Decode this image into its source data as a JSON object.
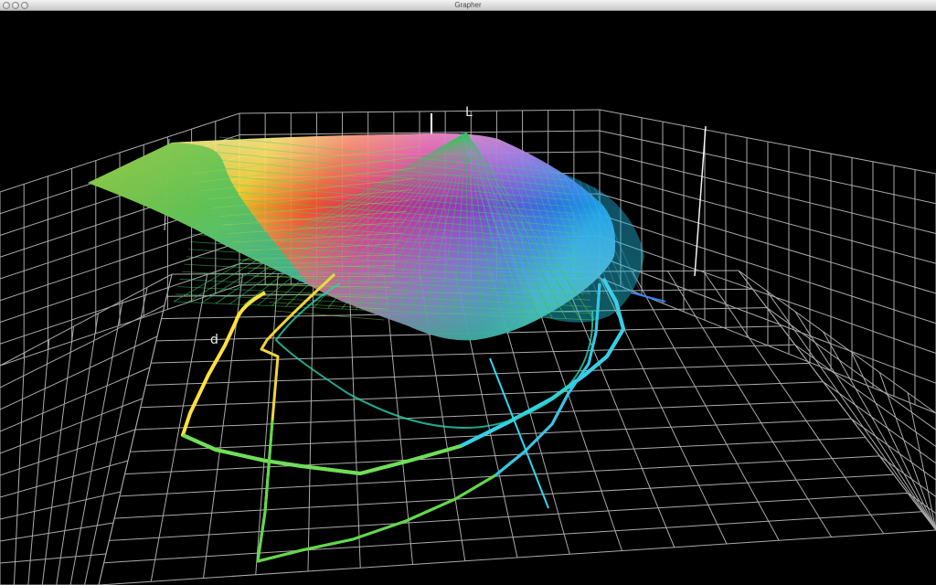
{
  "window": {
    "title": "Grapher",
    "buttons": [
      "close",
      "minimize",
      "zoom"
    ]
  },
  "plot": {
    "axis_labels": {
      "vertical": "L",
      "horizontal": "d"
    },
    "colors": {
      "background": "#000000",
      "grid": "#bdbdbd",
      "wireframe": "#37c25b",
      "yellow_trace": "#f3e23b",
      "cyan_trace": "#33d7e6",
      "blue_trace": "#2e7dff"
    }
  }
}
